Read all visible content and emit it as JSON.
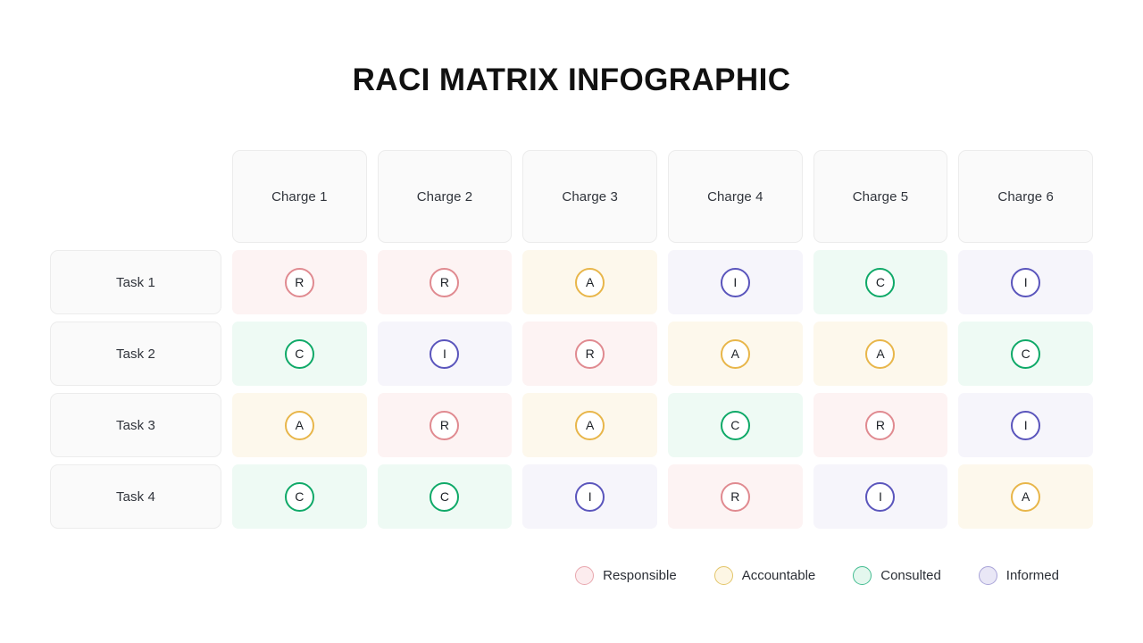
{
  "page": {
    "title": "RACI MATRIX INFOGRAPHIC"
  },
  "matrix": {
    "column_headers": [
      "Charge 1",
      "Charge 2",
      "Charge 3",
      "Charge 4",
      "Charge 5",
      "Charge 6"
    ],
    "row_headers": [
      "Task 1",
      "Task 2",
      "Task 3",
      "Task 4"
    ],
    "rows": [
      {
        "task": "Task 1",
        "cells": [
          "R",
          "R",
          "A",
          "I",
          "C",
          "I"
        ]
      },
      {
        "task": "Task 2",
        "cells": [
          "C",
          "I",
          "R",
          "A",
          "A",
          "C"
        ]
      },
      {
        "task": "Task 3",
        "cells": [
          "A",
          "R",
          "A",
          "C",
          "R",
          "I"
        ]
      },
      {
        "task": "Task 4",
        "cells": [
          "C",
          "C",
          "I",
          "R",
          "I",
          "A"
        ]
      }
    ]
  },
  "legend": {
    "items": [
      {
        "code": "R",
        "label": "Responsible",
        "color": "#e8a7ae"
      },
      {
        "code": "A",
        "label": "Accountable",
        "color": "#e3c569"
      },
      {
        "code": "C",
        "label": "Consulted",
        "color": "#45bd92"
      },
      {
        "code": "I",
        "label": "Informed",
        "color": "#a9a4d8"
      }
    ]
  }
}
